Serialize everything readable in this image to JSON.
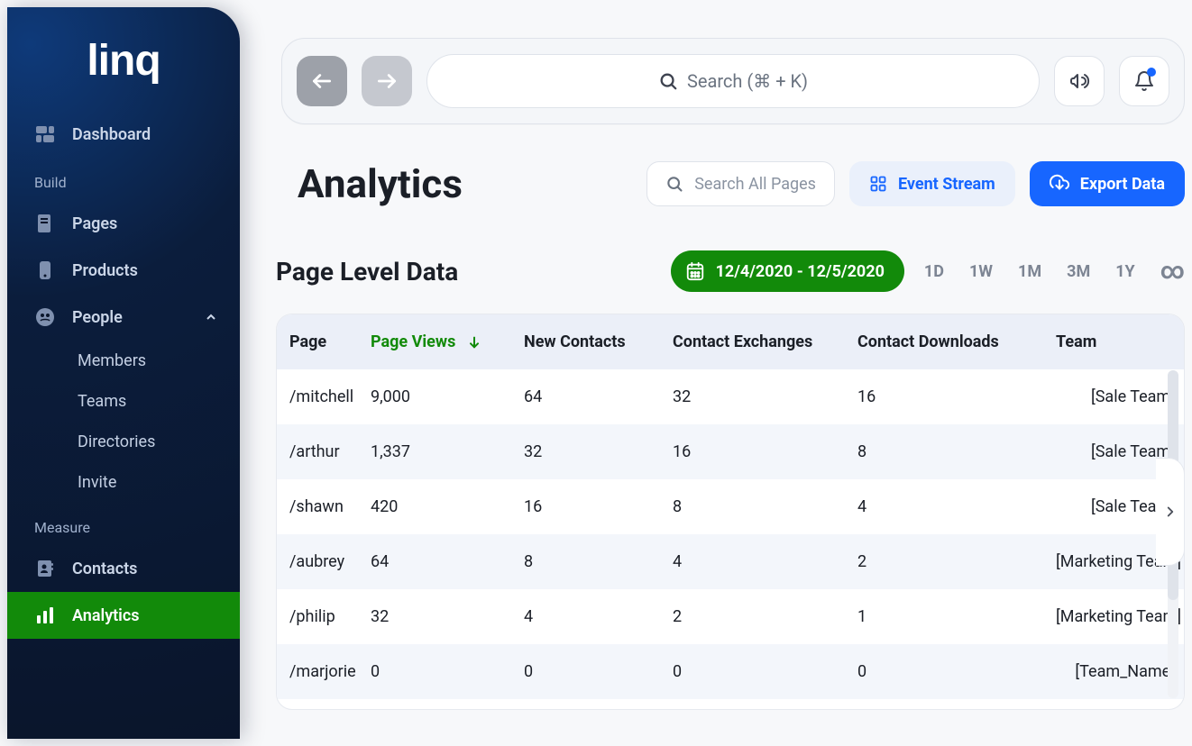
{
  "brand": {
    "logo_text": "linq"
  },
  "sidebar": {
    "dashboard_label": "Dashboard",
    "sections": {
      "build": "Build",
      "measure": "Measure"
    },
    "pages_label": "Pages",
    "products_label": "Products",
    "people_label": "People",
    "people_children": {
      "members": "Members",
      "teams": "Teams",
      "directories": "Directories",
      "invite": "Invite"
    },
    "contacts_label": "Contacts",
    "analytics_label": "Analytics"
  },
  "topbar": {
    "search_placeholder": "Search (⌘ + K)"
  },
  "page": {
    "title": "Analytics",
    "search_all_placeholder": "Search All Pages",
    "event_stream_label": "Event Stream",
    "export_label": "Export Data",
    "subtitle": "Page Level Data",
    "date_range_text": "12/4/2020 - 12/5/2020",
    "ranges": {
      "d1": "1D",
      "w1": "1W",
      "m1": "1M",
      "m3": "3M",
      "y1": "1Y",
      "inf": "∞"
    }
  },
  "table": {
    "columns": {
      "page": "Page",
      "page_views": "Page Views",
      "new_contacts": "New Contacts",
      "contact_exchanges": "Contact Exchanges",
      "contact_downloads": "Contact Downloads",
      "team": "Team"
    },
    "rows": [
      {
        "page": "/mitchell",
        "views": "9,000",
        "new_contacts": "64",
        "exchanges": "32",
        "downloads": "16",
        "team": "[Sale Team]"
      },
      {
        "page": "/arthur",
        "views": "1,337",
        "new_contacts": "32",
        "exchanges": "16",
        "downloads": "8",
        "team": "[Sale Team]"
      },
      {
        "page": "/shawn",
        "views": "420",
        "new_contacts": "16",
        "exchanges": "8",
        "downloads": "4",
        "team": "[Sale Team]"
      },
      {
        "page": "/aubrey",
        "views": "64",
        "new_contacts": "8",
        "exchanges": "4",
        "downloads": "2",
        "team": "[Marketing Team]"
      },
      {
        "page": "/philip",
        "views": "32",
        "new_contacts": "4",
        "exchanges": "2",
        "downloads": "1",
        "team": "[Marketing Team]"
      },
      {
        "page": "/marjorie",
        "views": "0",
        "new_contacts": "0",
        "exchanges": "0",
        "downloads": "0",
        "team": "[Team_Name]"
      }
    ]
  }
}
